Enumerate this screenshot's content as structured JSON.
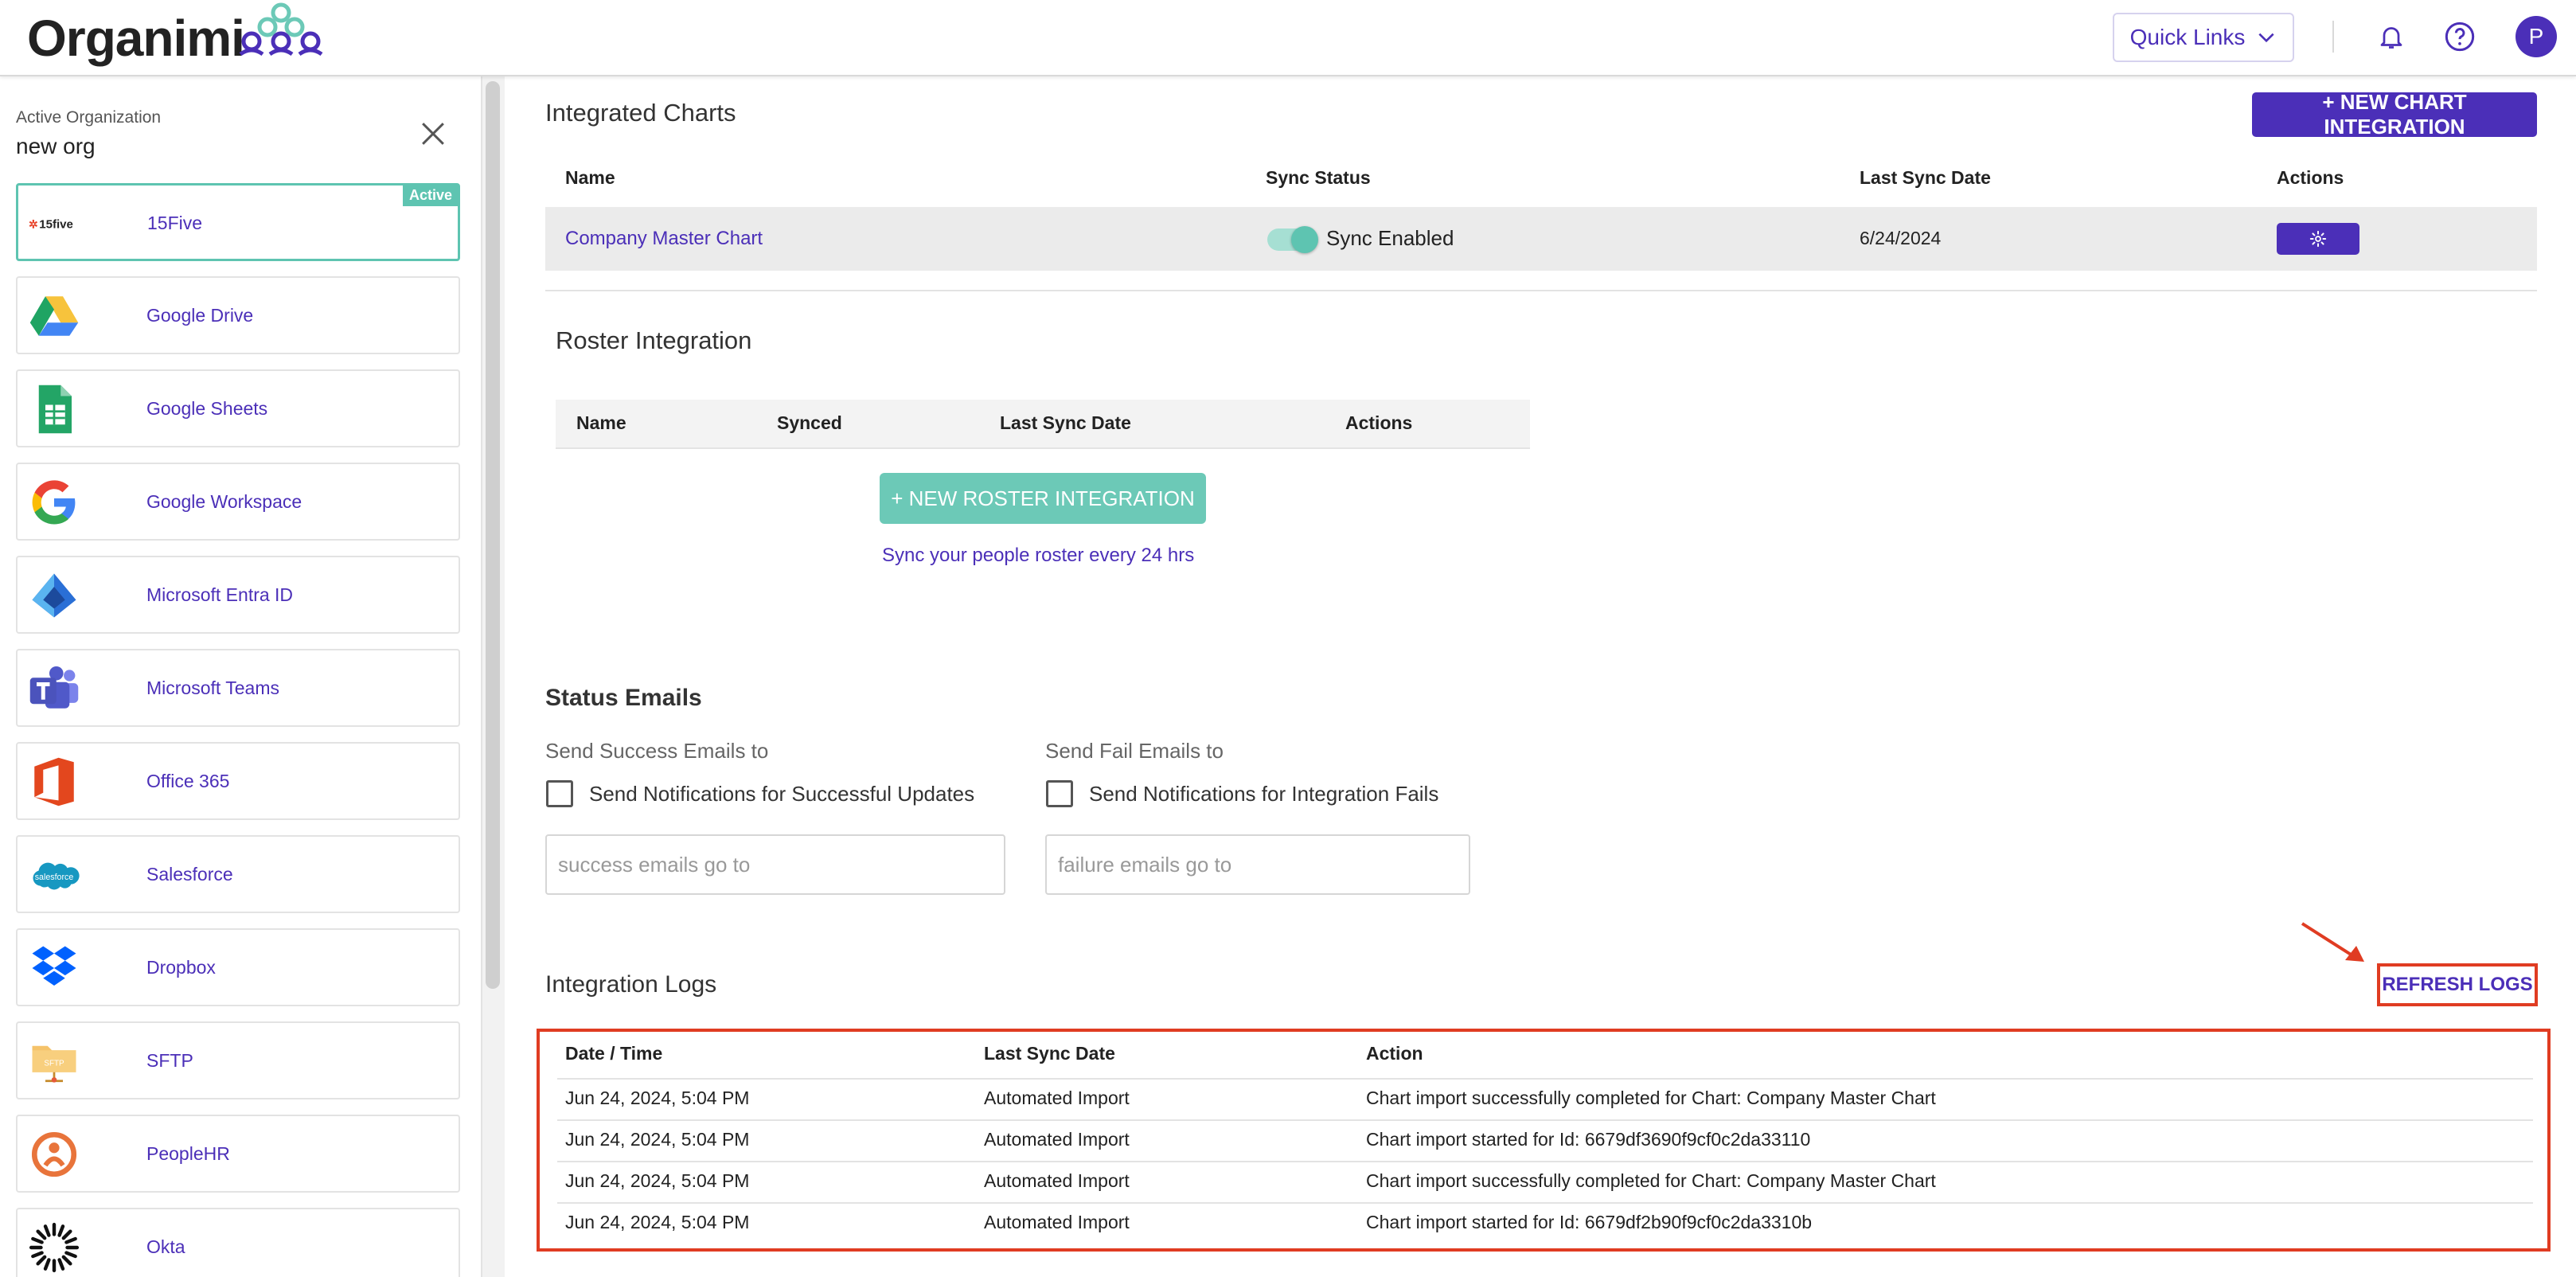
{
  "header": {
    "logo_text": "Organimi",
    "quick_links_label": "Quick Links",
    "avatar_initial": "P",
    "brand_color": "#4b2fb8",
    "accent_color": "#5ec4b1"
  },
  "sidebar": {
    "active_org_label": "Active Organization",
    "active_org_name": "new org",
    "items": [
      {
        "label": "15Five",
        "icon": "15five-icon",
        "active": true,
        "badge": "Active"
      },
      {
        "label": "Google Drive",
        "icon": "google-drive-icon"
      },
      {
        "label": "Google Sheets",
        "icon": "google-sheets-icon"
      },
      {
        "label": "Google Workspace",
        "icon": "google-workspace-icon"
      },
      {
        "label": "Microsoft Entra ID",
        "icon": "microsoft-entra-icon"
      },
      {
        "label": "Microsoft Teams",
        "icon": "microsoft-teams-icon"
      },
      {
        "label": "Office 365",
        "icon": "office-365-icon"
      },
      {
        "label": "Salesforce",
        "icon": "salesforce-icon"
      },
      {
        "label": "Dropbox",
        "icon": "dropbox-icon"
      },
      {
        "label": "SFTP",
        "icon": "sftp-icon"
      },
      {
        "label": "PeopleHR",
        "icon": "peoplehr-icon"
      },
      {
        "label": "Okta",
        "icon": "okta-icon"
      }
    ]
  },
  "integrated_charts": {
    "title": "Integrated Charts",
    "new_button": "+ NEW CHART INTEGRATION",
    "columns": [
      "Name",
      "Sync Status",
      "Last Sync Date",
      "Actions"
    ],
    "rows": [
      {
        "name": "Company Master Chart",
        "sync_status": "Sync Enabled",
        "last_sync": "6/24/2024"
      }
    ]
  },
  "roster": {
    "title": "Roster Integration",
    "columns": [
      "Name",
      "Synced",
      "Last Sync Date",
      "Actions"
    ],
    "new_button": "+ NEW ROSTER INTEGRATION",
    "note": "Sync your people roster every 24 hrs"
  },
  "status_emails": {
    "title": "Status Emails",
    "success_label": "Send Success Emails to",
    "success_checkbox": "Send Notifications for Successful Updates",
    "success_placeholder": "success emails go to",
    "fail_label": "Send Fail Emails to",
    "fail_checkbox": "Send Notifications for Integration Fails",
    "fail_placeholder": "failure emails go to"
  },
  "logs": {
    "title": "Integration Logs",
    "refresh_button": "REFRESH LOGS",
    "columns": [
      "Date / Time",
      "Last Sync Date",
      "Action"
    ],
    "rows": [
      {
        "datetime": "Jun 24, 2024, 5:04 PM",
        "type": "Automated Import",
        "action": "Chart import successfully completed for Chart: Company Master Chart"
      },
      {
        "datetime": "Jun 24, 2024, 5:04 PM",
        "type": "Automated Import",
        "action": "Chart import started for Id: 6679df3690f9cf0c2da33110"
      },
      {
        "datetime": "Jun 24, 2024, 5:04 PM",
        "type": "Automated Import",
        "action": "Chart import successfully completed for Chart: Company Master Chart"
      },
      {
        "datetime": "Jun 24, 2024, 5:04 PM",
        "type": "Automated Import",
        "action": "Chart import started for Id: 6679df2b90f9cf0c2da3310b"
      }
    ]
  },
  "annotation_color": "#e03c22"
}
